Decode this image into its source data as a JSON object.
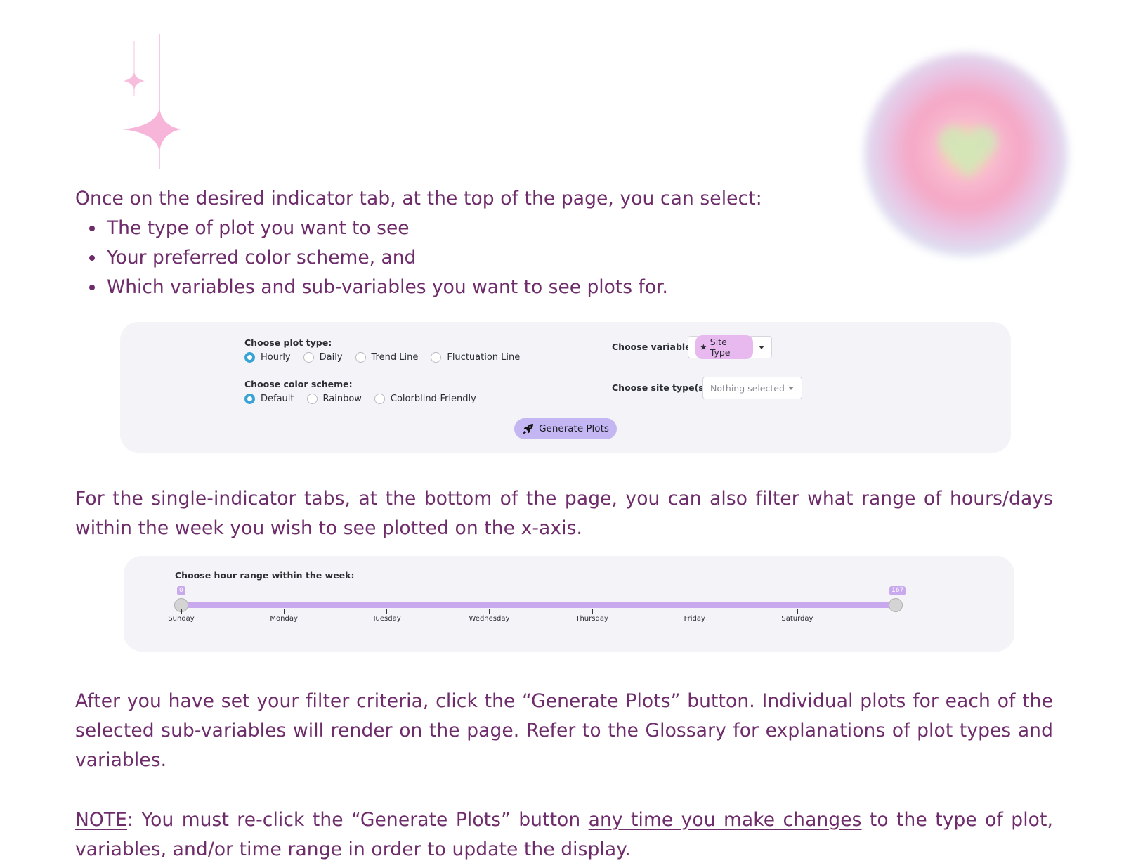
{
  "intro": "Once on the desired indicator tab, at the top of the page, you can select:",
  "bullets": [
    "The type of plot you want to see",
    "Your preferred color scheme, and",
    "Which variables and sub-variables you want to see plots for."
  ],
  "controls": {
    "plot_type_label": "Choose plot type:",
    "plot_types": [
      "Hourly",
      "Daily",
      "Trend Line",
      "Fluctuation Line"
    ],
    "plot_type_selected": "Hourly",
    "color_scheme_label": "Choose color scheme:",
    "color_schemes": [
      "Default",
      "Rainbow",
      "Colorblind-Friendly"
    ],
    "color_scheme_selected": "Default",
    "variable_label": "Choose variable:",
    "variable_value": "Site Type",
    "site_type_label": "Choose site type(s):",
    "site_type_placeholder": "Nothing selected",
    "generate_label": "Generate Plots"
  },
  "paragraph2": "For the single-indicator tabs, at the bottom of the page, you can also filter what range of hours/days within the week you wish to see plotted on the x-axis.",
  "slider": {
    "label": "Choose hour range within the week:",
    "min_value": "0",
    "max_value": "167",
    "range": {
      "min": 0,
      "max": 167,
      "from": 0,
      "to": 167
    },
    "ticks": [
      "Sunday",
      "Monday",
      "Tuesday",
      "Wednesday",
      "Thursday",
      "Friday",
      "Saturday"
    ]
  },
  "paragraph3": "After you have set your filter criteria, click the “Generate Plots” button. Individual plots for each of the selected sub-variables will render on the page. Refer to the Glossary for explanations of plot types and variables.",
  "note": {
    "label": "NOTE",
    "part1": ": You must re-click the “Generate Plots” button ",
    "emphasis": "any time you make changes",
    "part2": " to the type of plot, variables, and/or time range in order to update the display."
  },
  "colors": {
    "text": "#6e2c6b",
    "panel_bg": "#f3f3f8",
    "accent_purple": "#c4b5f3",
    "slider": "#c9a9ee",
    "radio_checked": "#3aa3d6",
    "pill": "#e7b9ef"
  }
}
